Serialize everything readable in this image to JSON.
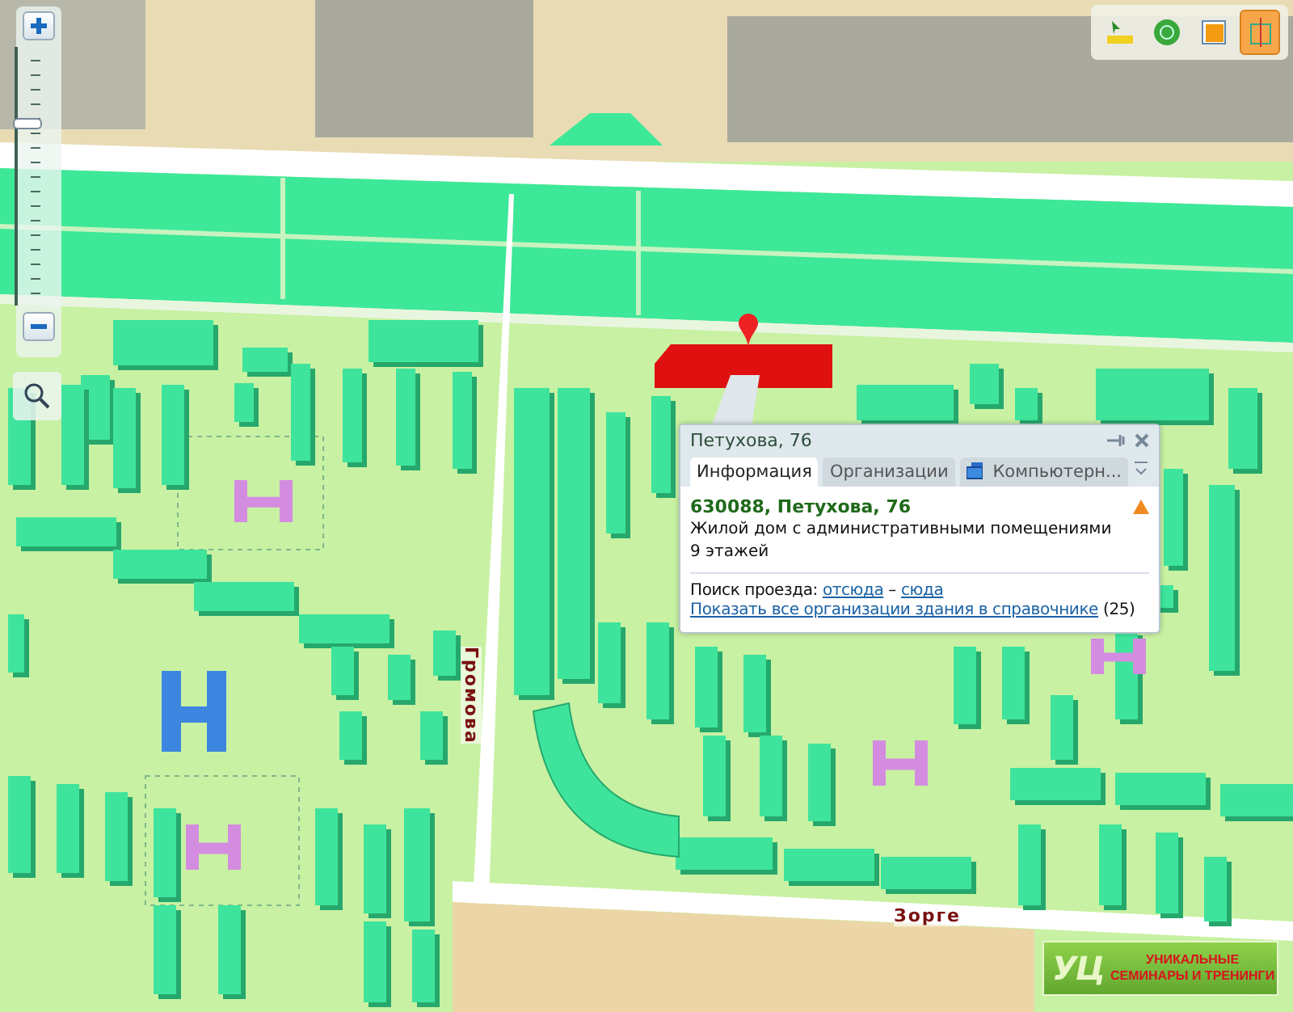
{
  "zoom_control": {
    "level": 0.7
  },
  "toolbar": {
    "buttons": [
      {
        "selected": false
      },
      {
        "selected": false
      },
      {
        "selected": false
      },
      {
        "selected": true
      }
    ]
  },
  "map": {
    "streets": [
      {
        "name": "Громова",
        "kind": "vertical"
      },
      {
        "name": "Зорге",
        "kind": "horizontal"
      }
    ]
  },
  "popup": {
    "title": "Петухова, 76",
    "tabs": [
      {
        "label": "Информация",
        "selected": true,
        "kind": "text"
      },
      {
        "label": "Организации",
        "selected": false,
        "kind": "text"
      },
      {
        "label": "Компьютерн...",
        "selected": false,
        "kind": "icon"
      }
    ],
    "address": "630088, Петухова, 76",
    "description": "Жилой дом с административными помещениями",
    "floors": "9 этажей",
    "route": {
      "label": "Поиск проезда:",
      "from": "отсюда",
      "separator": "–",
      "to": "сюда"
    },
    "directory_link": "Показать все организации здания в справочнике",
    "directory_count": "(25)"
  },
  "ad_banner": {
    "logo": "УЦ",
    "line_1": "УНИКАЛЬНЫЕ",
    "line_2": "СЕМИНАРЫ И ТРЕНИНГИ"
  }
}
